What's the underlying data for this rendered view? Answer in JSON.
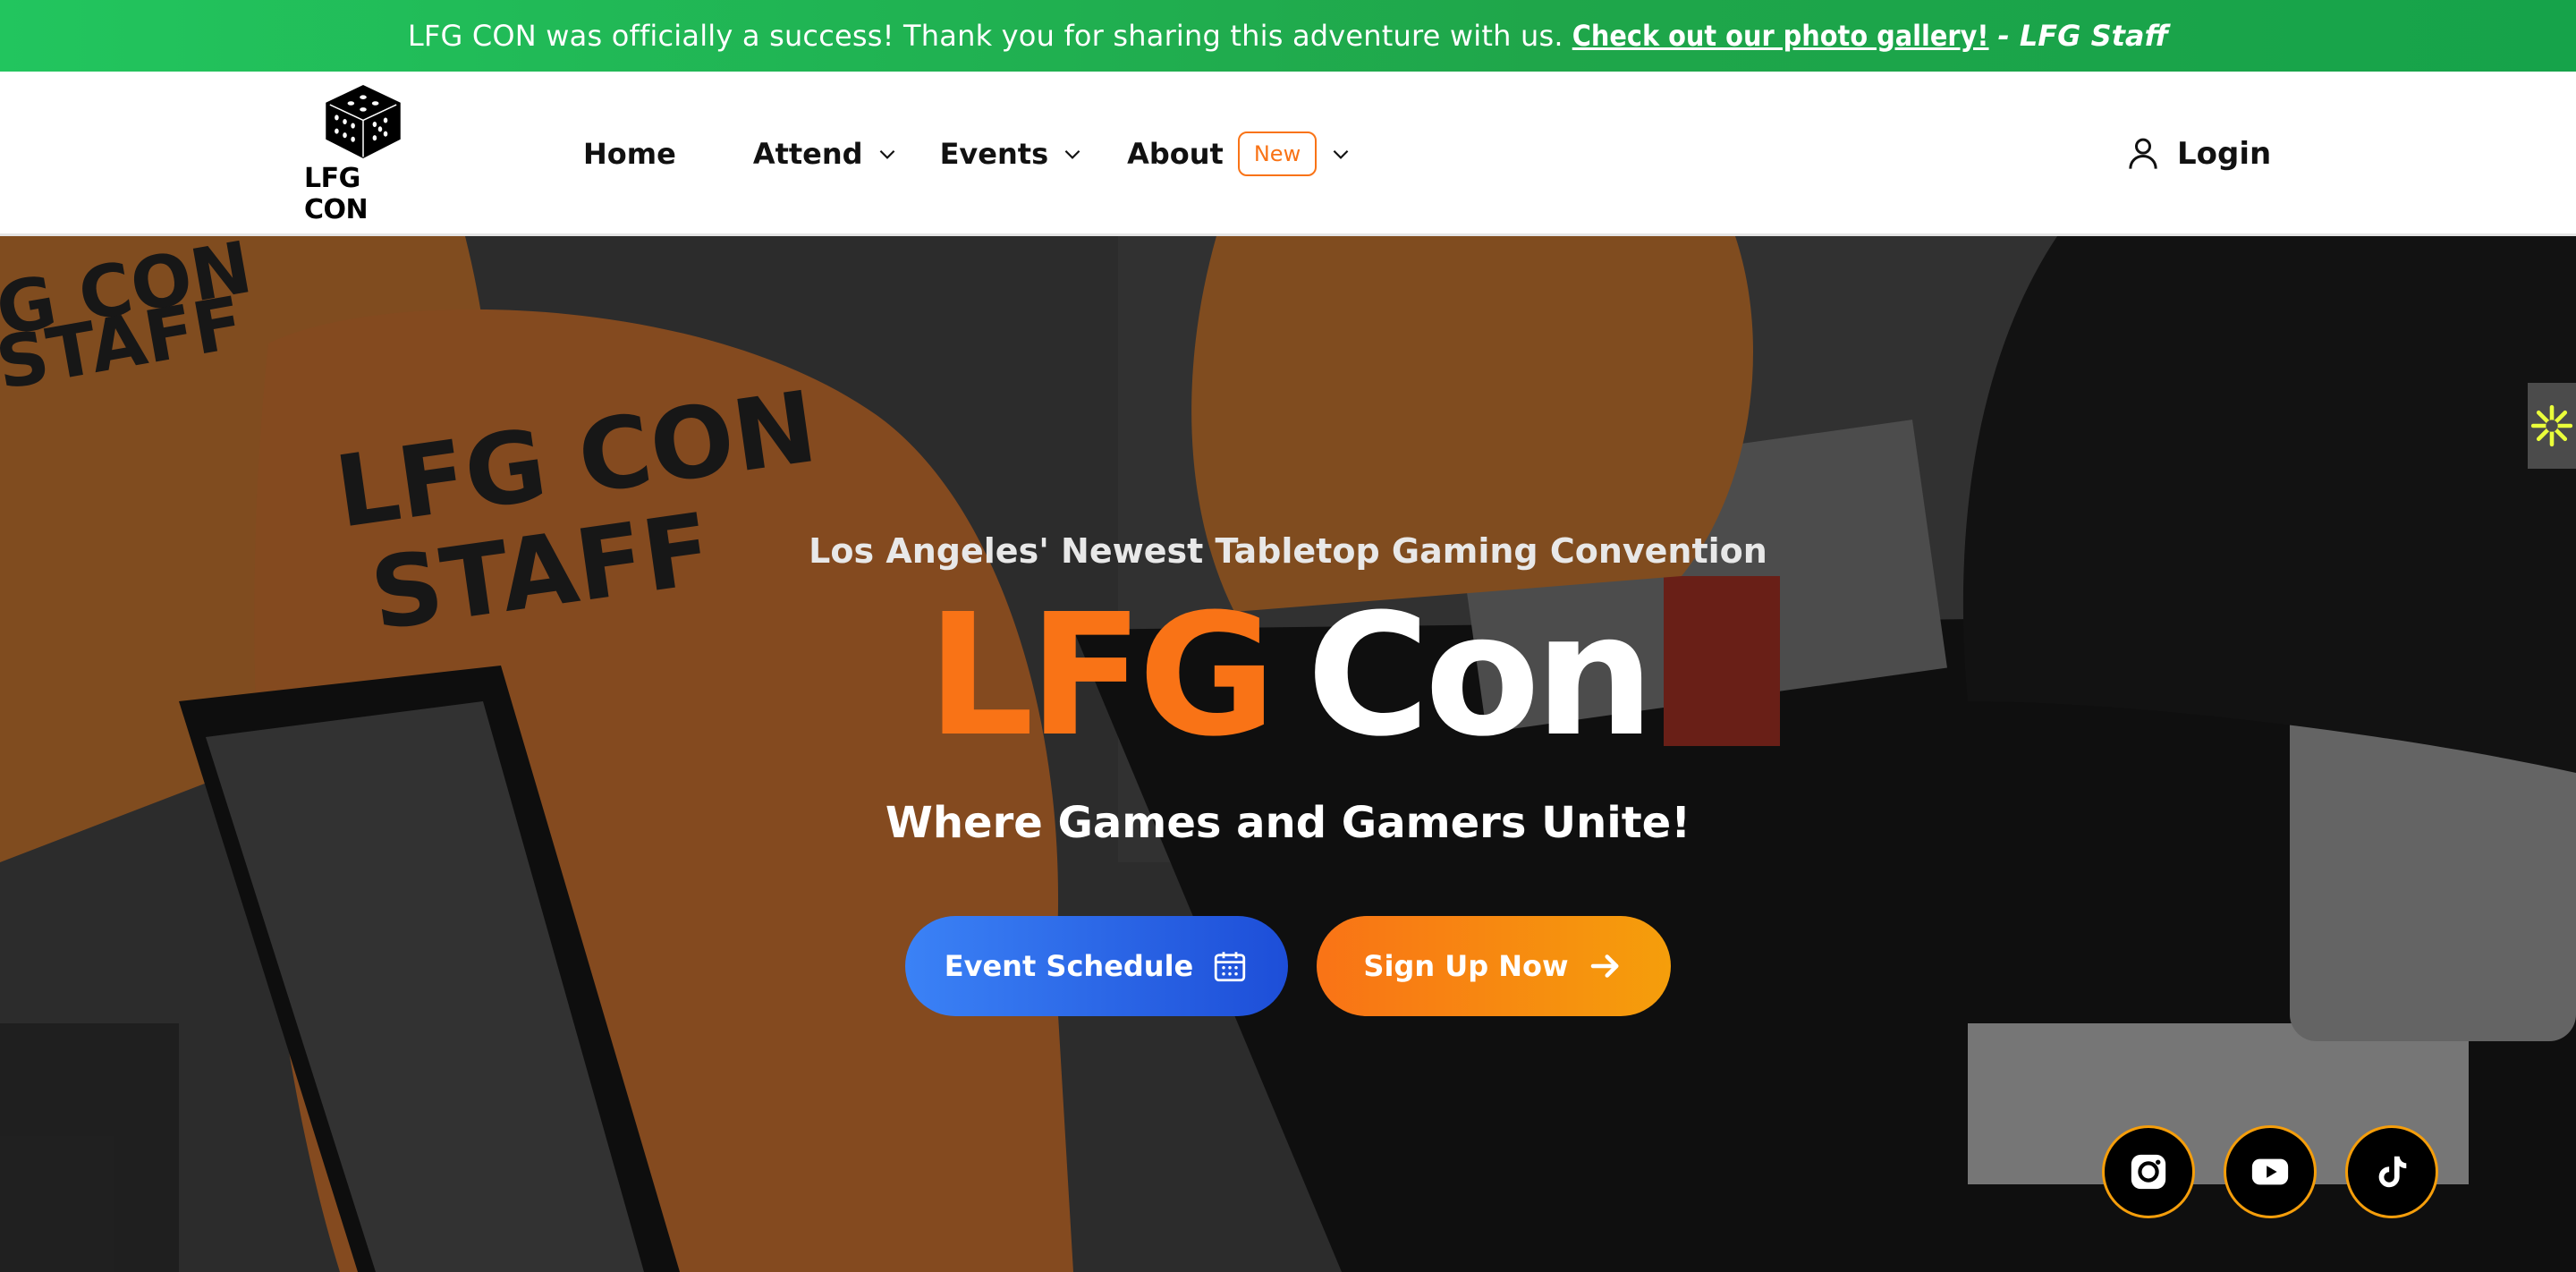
{
  "announcement": {
    "message": "LFG CON was officially a success! Thank you for sharing this adventure with us.",
    "link_text": "Check out our photo gallery!",
    "signature": "- LFG Staff"
  },
  "header": {
    "logo_text": "LFG CON",
    "nav": {
      "home": "Home",
      "attend": "Attend",
      "events": "Events",
      "about": "About",
      "about_badge": "New"
    },
    "login": "Login"
  },
  "hero": {
    "subtitle": "Los Angeles' Newest Tabletop Gaming Convention",
    "title_part1": "LFG",
    "title_part2": "Con",
    "tagline": "Where Games and Gamers Unite!",
    "btn_schedule": "Event Schedule",
    "btn_signup": "Sign Up Now"
  },
  "icons": {
    "social": [
      "instagram-icon",
      "youtube-icon",
      "tiktok-icon"
    ],
    "widget": "accessibility-icon"
  },
  "colors": {
    "announcement": "#22c55e",
    "accent_orange": "#f97316",
    "accent_blue": "#3b82f6",
    "widget_yellow": "#eaff3a"
  }
}
